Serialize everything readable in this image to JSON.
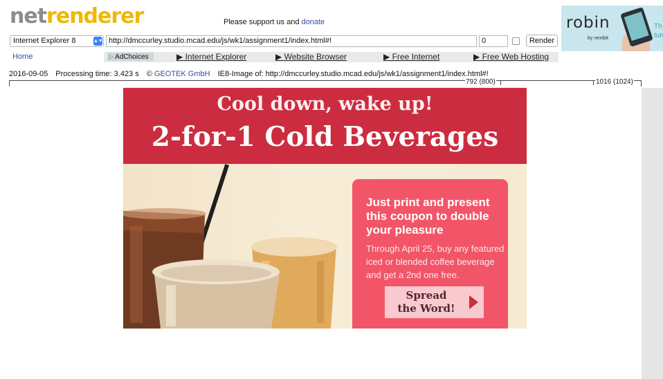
{
  "header": {
    "logo_part1": "net",
    "logo_part2": "renderer",
    "support_text": "Please support us and ",
    "donate_link": "donate"
  },
  "ad": {
    "brand": "robin",
    "sub": "by nextbit",
    "tail_line1": "Th",
    "tail_line2": "turr"
  },
  "toolbar": {
    "browser_selected": "Internet Explorer 8",
    "url_value": "http://dmccurley.studio.mcad.edu/js/wk1/assignment1/index.html#!",
    "number_value": "0",
    "render_label": "Render"
  },
  "nav": {
    "home": "Home",
    "adchoices": "AdChoices",
    "links": [
      "Internet Explorer",
      "Website Browser",
      "Free Internet",
      "Free Web Hosting"
    ]
  },
  "status": {
    "date": "2016-09-05",
    "processing": "Processing time: 3.423 s",
    "copyright": "© ",
    "company": "GEOTEK GmbH",
    "image_of": "IE8-Image of: http://dmccurley.studio.mcad.edu/js/wk1/assignment1/index.html#!"
  },
  "ruler": {
    "mark1": "792 (800)",
    "mark2": "1016 (1024)"
  },
  "banner": {
    "headline1": "Cool down, wake up!",
    "headline2": "2-for-1 Cold Beverages",
    "promo_head": "Just print and present this coupon to double your pleasure",
    "promo_body": "Through April 25, buy any featured iced or blended coffee beverage and get a 2nd one free.",
    "spread_line1": "Spread",
    "spread_line2": "the Word!",
    "colors": {
      "top": "#cc2c3f",
      "promo": "#f25568",
      "button": "#f8c9cf"
    }
  }
}
